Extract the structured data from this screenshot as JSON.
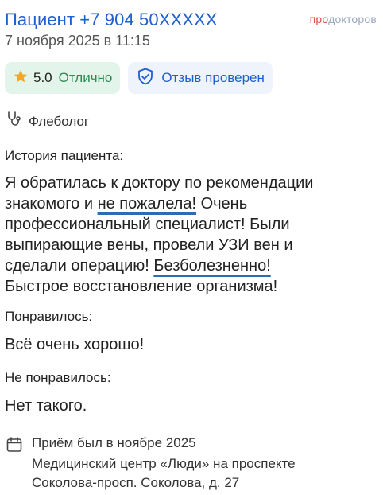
{
  "header": {
    "patient": "Пациент +7 904 50XXXXX",
    "date": "7 ноября 2025 в 11:15",
    "brand_pro": "про",
    "brand_rest": "докторов"
  },
  "badges": {
    "rating_score": "5.0",
    "rating_grade": "Отлично",
    "verified_label": "Отзыв проверен"
  },
  "specialty": "Флеболог",
  "history": {
    "title": "История пациента:",
    "text_1": "Я обратилась к доктору по рекомендации знакомого и ",
    "highlight_1": "не пожалела!",
    "text_2": " Очень профессиональный специалист! Были выпирающие вены, провели УЗИ вен и сделали операцию! ",
    "highlight_2": "Безболезненно!",
    "text_3": " Быстрое восстановление организма!"
  },
  "liked": {
    "title": "Понравилось:",
    "text": "Всё очень хорошо!"
  },
  "disliked": {
    "title": "Не понравилось:",
    "text": "Нет такого."
  },
  "visit": {
    "when": "Приём был в ноябре 2025",
    "clinic_line_1": "Медицинский центр «Люди» на проспекте",
    "clinic_line_2": "Соколова-просп. Соколова, д. 27"
  },
  "colors": {
    "accent": "#1f5fcf",
    "rating_bg": "#e3f5ea",
    "grade": "#2f8a52",
    "star": "#f5a623",
    "underline": "#2b6cb3"
  }
}
